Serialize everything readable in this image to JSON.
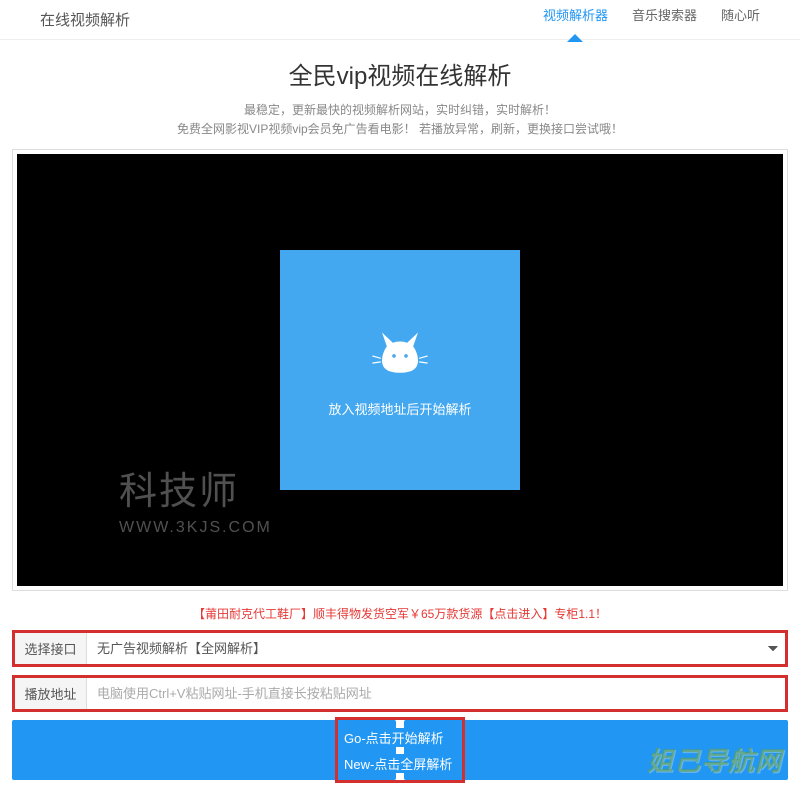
{
  "header": {
    "brand": "在线视频解析",
    "nav": [
      {
        "label": "视频解析器",
        "active": true
      },
      {
        "label": "音乐搜索器",
        "active": false
      },
      {
        "label": "随心听",
        "active": false
      }
    ]
  },
  "title": "全民vip视频在线解析",
  "subtitle1": "最稳定，更新最快的视频解析网站，实时纠错，实时解析！",
  "subtitle2": "免费全网影视VIP视频vip会员免广告看电影！ 若播放异常，刷新，更换接口尝试哦！",
  "player": {
    "placeholder": "放入视频地址后开始解析"
  },
  "watermark": {
    "line1": "科技师",
    "line2": "WWW.3KJS.COM"
  },
  "promo": "【莆田耐克代工鞋厂】顺丰得物发货空军￥65万款货源【点击进入】专柜1.1！",
  "form": {
    "interfaceLabel": "选择接口",
    "interfaceValue": "无广告视频解析【全网解析】",
    "urlLabel": "播放地址",
    "urlPlaceholder": "电脑使用Ctrl+V粘贴网址-手机直接长按粘贴网址"
  },
  "buttons": {
    "go": "Go-点击开始解析",
    "new": "New-点击全屏解析"
  },
  "footerWatermark": "姐己导航网"
}
